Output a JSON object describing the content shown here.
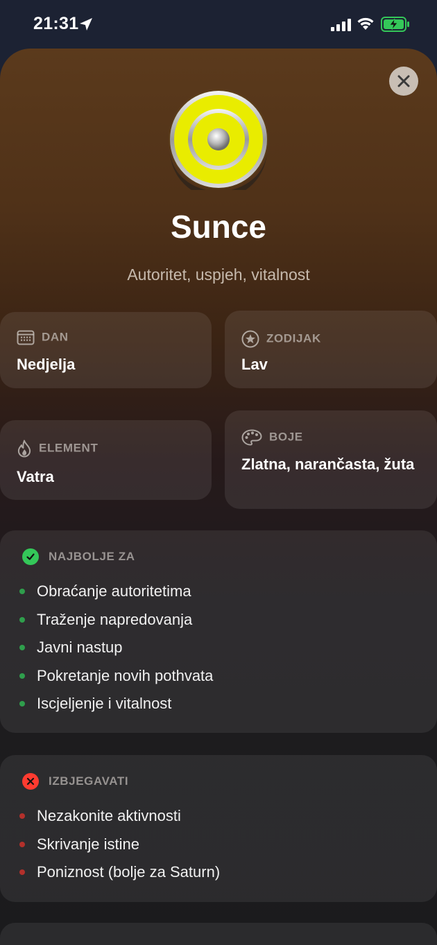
{
  "status": {
    "time": "21:31"
  },
  "planet": {
    "name": "Sunce",
    "subtitle": "Autoritet, uspjeh, vitalnost",
    "accent": "#e8ec00"
  },
  "cards": {
    "day": {
      "label": "DAN",
      "value": "Nedjelja",
      "icon": "calendar-icon"
    },
    "zodiac": {
      "label": "ZODIJAK",
      "value": "Lav",
      "icon": "star-circle-icon"
    },
    "element": {
      "label": "ELEMENT",
      "value": "Vatra",
      "icon": "flame-icon"
    },
    "colors": {
      "label": "BOJE",
      "value": "Zlatna, narančasta, žuta",
      "icon": "palette-icon"
    }
  },
  "best_for": {
    "label": "NAJBOLJE ZA",
    "color": "#34c759",
    "items": [
      "Obraćanje autoritetima",
      "Traženje napredovanja",
      "Javni nastup",
      "Pokretanje novih pothvata",
      "Iscjeljenje i vitalnost"
    ]
  },
  "avoid": {
    "label": "IZBJEGAVATI",
    "color": "#ff3b30",
    "items": [
      "Nezakonite aktivnosti",
      "Skrivanje istine",
      "Poniznost (bolje za Saturn)"
    ]
  }
}
